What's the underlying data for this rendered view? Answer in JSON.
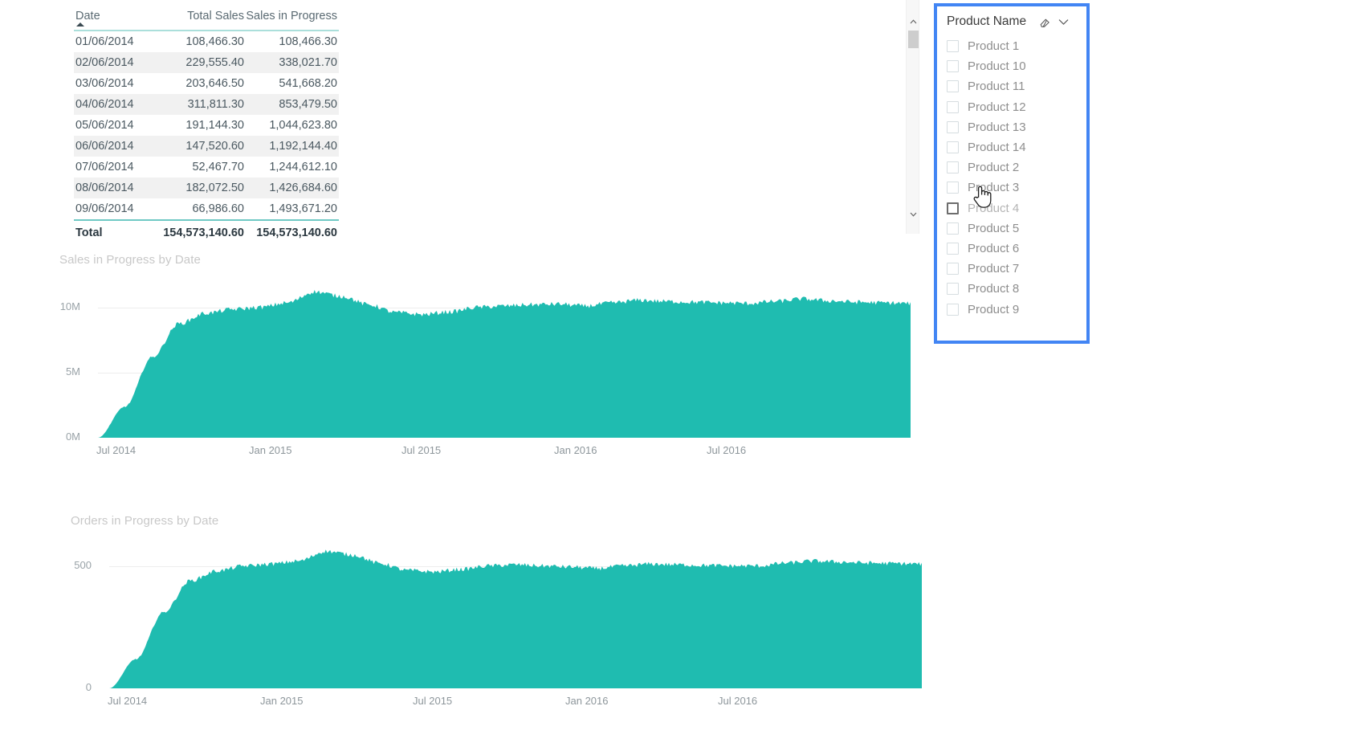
{
  "table": {
    "name": "sales-progress-table",
    "columns": [
      "Date",
      "Total Sales",
      "Sales in Progress"
    ],
    "sort": {
      "column": "Date",
      "direction": "ascending",
      "icon": "sort-ascending-icon"
    },
    "rows": [
      {
        "date": "01/06/2014",
        "total_sales": "108,466.30",
        "sales_in_progress": "108,466.30"
      },
      {
        "date": "02/06/2014",
        "total_sales": "229,555.40",
        "sales_in_progress": "338,021.70"
      },
      {
        "date": "03/06/2014",
        "total_sales": "203,646.50",
        "sales_in_progress": "541,668.20"
      },
      {
        "date": "04/06/2014",
        "total_sales": "311,811.30",
        "sales_in_progress": "853,479.50"
      },
      {
        "date": "05/06/2014",
        "total_sales": "191,144.30",
        "sales_in_progress": "1,044,623.80"
      },
      {
        "date": "06/06/2014",
        "total_sales": "147,520.60",
        "sales_in_progress": "1,192,144.40"
      },
      {
        "date": "07/06/2014",
        "total_sales": "52,467.70",
        "sales_in_progress": "1,244,612.10"
      },
      {
        "date": "08/06/2014",
        "total_sales": "182,072.50",
        "sales_in_progress": "1,426,684.60"
      },
      {
        "date": "09/06/2014",
        "total_sales": "66,986.60",
        "sales_in_progress": "1,493,671.20"
      }
    ],
    "total": {
      "label": "Total",
      "total_sales": "154,573,140.60",
      "sales_in_progress": "154,573,140.60"
    },
    "scrollbar": {
      "up_icon": "chevron-up-icon",
      "down_icon": "chevron-down-icon"
    }
  },
  "slicer": {
    "title": "Product Name",
    "clear_icon": "eraser-icon",
    "expand_icon": "chevron-down-icon",
    "focus_color": "#4285f4",
    "items": [
      {
        "label": "Product 1",
        "checked": false,
        "hover": false
      },
      {
        "label": "Product 10",
        "checked": false,
        "hover": false
      },
      {
        "label": "Product 11",
        "checked": false,
        "hover": false
      },
      {
        "label": "Product 12",
        "checked": false,
        "hover": false
      },
      {
        "label": "Product 13",
        "checked": false,
        "hover": false
      },
      {
        "label": "Product 14",
        "checked": false,
        "hover": false
      },
      {
        "label": "Product 2",
        "checked": false,
        "hover": false
      },
      {
        "label": "Product 3",
        "checked": false,
        "hover": false
      },
      {
        "label": "Product 4",
        "checked": false,
        "hover": true
      },
      {
        "label": "Product 5",
        "checked": false,
        "hover": false
      },
      {
        "label": "Product 6",
        "checked": false,
        "hover": false
      },
      {
        "label": "Product 7",
        "checked": false,
        "hover": false
      },
      {
        "label": "Product 8",
        "checked": false,
        "hover": false
      },
      {
        "label": "Product 9",
        "checked": false,
        "hover": false
      }
    ]
  },
  "cursor": {
    "type": "pointing-hand-cursor"
  },
  "chart_data": [
    {
      "id": "sales-in-progress-chart",
      "type": "area",
      "title": "Sales in Progress by Date",
      "xlabel": "",
      "ylabel": "",
      "series_color": "#1fbcb0",
      "grid": true,
      "legend": "none",
      "ylim": [
        0,
        12500000
      ],
      "yticks": [
        0,
        5000000,
        10000000
      ],
      "ytick_labels": [
        "0M",
        "5M",
        "10M"
      ],
      "xtick_labels": [
        "Jul 2014",
        "Jan 2015",
        "Jul 2015",
        "Jan 2016",
        "Jul 2016"
      ],
      "x": [
        "2014-06",
        "2014-07",
        "2014-08",
        "2014-09",
        "2014-10",
        "2014-11",
        "2014-12",
        "2015-01",
        "2015-02",
        "2015-03",
        "2015-04",
        "2015-05",
        "2015-06",
        "2015-07",
        "2015-08",
        "2015-09",
        "2015-10",
        "2015-11",
        "2015-12",
        "2016-01",
        "2016-02",
        "2016-03",
        "2016-04",
        "2016-05",
        "2016-06",
        "2016-07",
        "2016-08",
        "2016-09",
        "2016-10",
        "2016-11",
        "2016-12"
      ],
      "values": [
        0,
        2400000,
        6200000,
        8800000,
        9600000,
        9900000,
        10050000,
        10400000,
        11250000,
        10900000,
        10250000,
        9650000,
        9500000,
        9700000,
        10050000,
        10150000,
        10250000,
        10300000,
        10150000,
        10400000,
        10600000,
        10500000,
        10450000,
        10400000,
        10350000,
        10500000,
        10700000,
        10550000,
        10450000,
        10400000,
        10350000
      ]
    },
    {
      "id": "orders-in-progress-chart",
      "type": "area",
      "title": "Orders in Progress by Date",
      "xlabel": "",
      "ylabel": "",
      "series_color": "#1fbcb0",
      "grid": true,
      "legend": "none",
      "ylim": [
        0,
        620
      ],
      "yticks": [
        0,
        500
      ],
      "ytick_labels": [
        "0",
        "500"
      ],
      "xtick_labels": [
        "Jul 2014",
        "Jan 2015",
        "Jul 2015",
        "Jan 2016",
        "Jul 2016"
      ],
      "x": [
        "2014-06",
        "2014-07",
        "2014-08",
        "2014-09",
        "2014-10",
        "2014-11",
        "2014-12",
        "2015-01",
        "2015-02",
        "2015-03",
        "2015-04",
        "2015-05",
        "2015-06",
        "2015-07",
        "2015-08",
        "2015-09",
        "2015-10",
        "2015-11",
        "2015-12",
        "2016-01",
        "2016-02",
        "2016-03",
        "2016-04",
        "2016-05",
        "2016-06",
        "2016-07",
        "2016-08",
        "2016-09",
        "2016-10",
        "2016-11",
        "2016-12"
      ],
      "values": [
        0,
        120,
        310,
        440,
        480,
        500,
        508,
        520,
        560,
        545,
        510,
        482,
        476,
        486,
        500,
        505,
        500,
        496,
        490,
        500,
        508,
        505,
        502,
        500,
        500,
        512,
        520,
        516,
        512,
        510,
        508
      ]
    }
  ]
}
